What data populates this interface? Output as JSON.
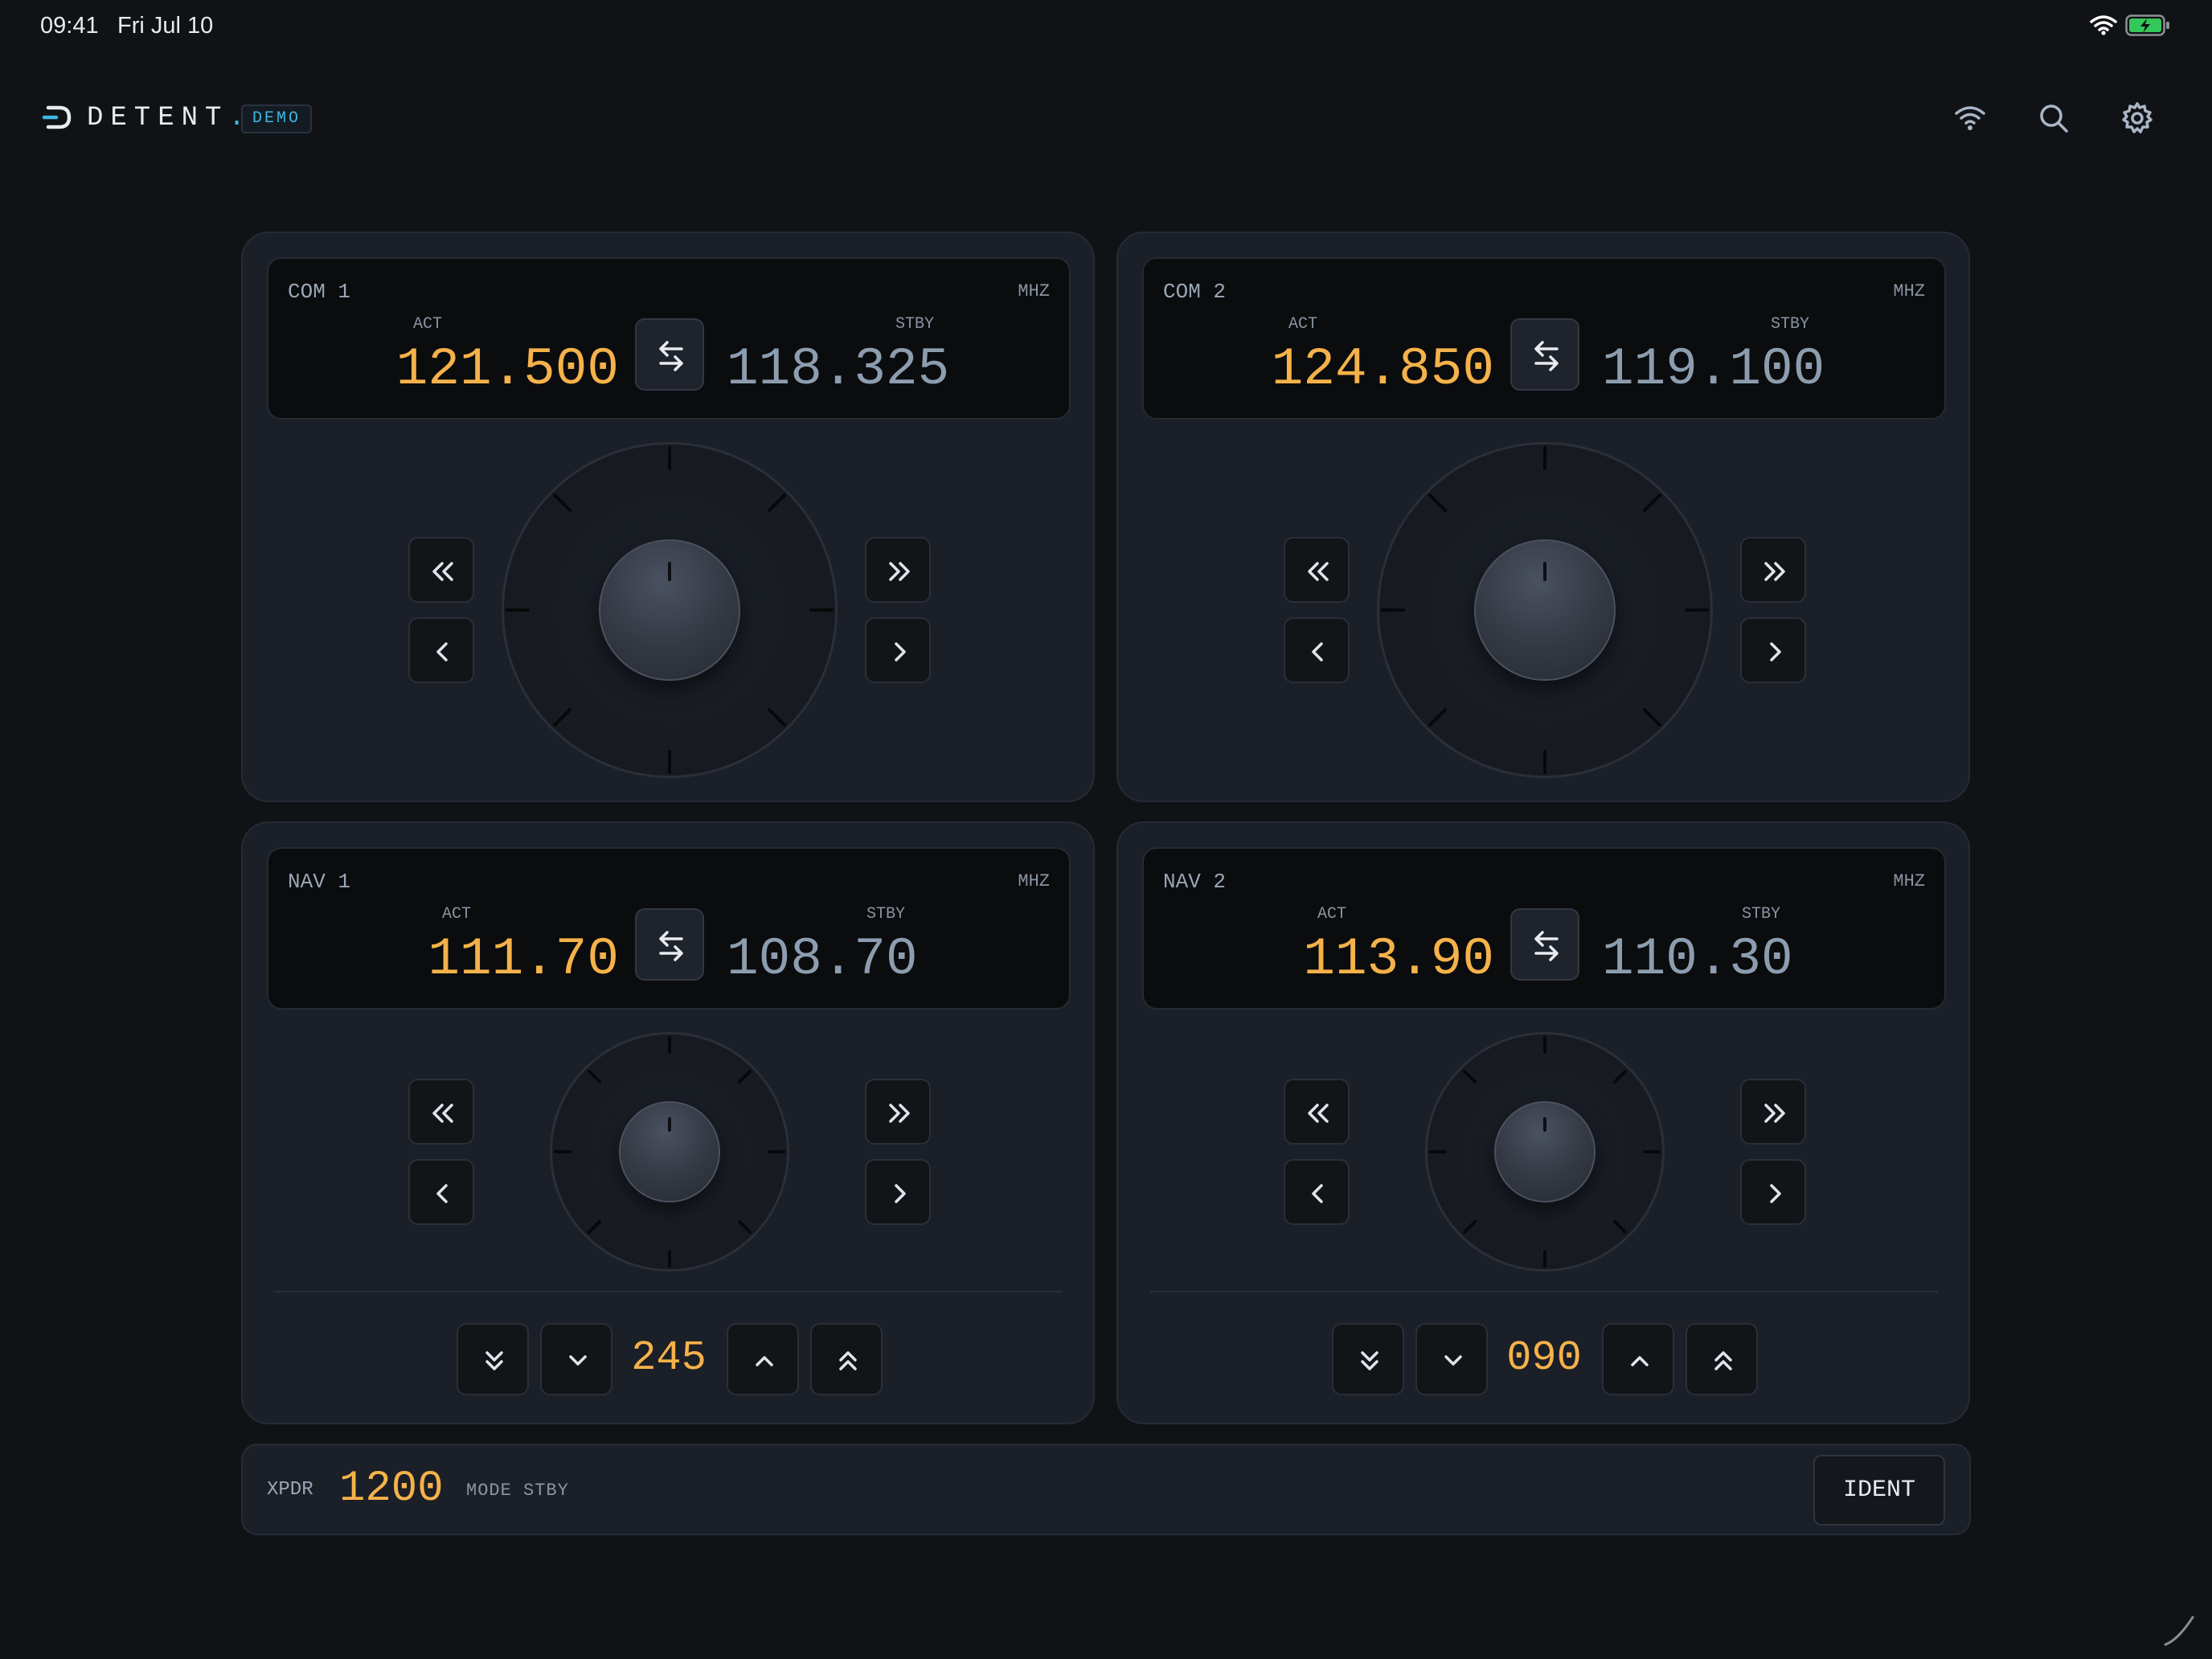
{
  "status_bar": {
    "time": "09:41",
    "date": "Fri Jul 10"
  },
  "header": {
    "brand": "DETENT",
    "brand_dot": ".",
    "badge": "DEMO"
  },
  "header_icons": [
    "wifi-icon",
    "search-icon",
    "gear-icon"
  ],
  "radios": [
    {
      "name": "COM 1",
      "unit": "MHZ",
      "act_label": "ACT",
      "stby_label": "STBY",
      "active": "121.500",
      "standby": "118.325"
    },
    {
      "name": "COM 2",
      "unit": "MHZ",
      "act_label": "ACT",
      "stby_label": "STBY",
      "active": "124.850",
      "standby": "119.100"
    },
    {
      "name": "NAV 1",
      "unit": "MHZ",
      "act_label": "ACT",
      "stby_label": "STBY",
      "active": "111.70",
      "standby": "108.70",
      "obs": "245"
    },
    {
      "name": "NAV 2",
      "unit": "MHZ",
      "act_label": "ACT",
      "stby_label": "STBY",
      "active": "113.90",
      "standby": "110.30",
      "obs": "090"
    }
  ],
  "transponder": {
    "label": "XPDR",
    "code": "1200",
    "mode": "MODE STBY",
    "ident_label": "IDENT"
  },
  "colors": {
    "accent_active": "#f5b24a",
    "standby": "#8d9db0",
    "brand_accent": "#3ab8e0",
    "background": "#101216",
    "panel": "#1b1f27"
  }
}
